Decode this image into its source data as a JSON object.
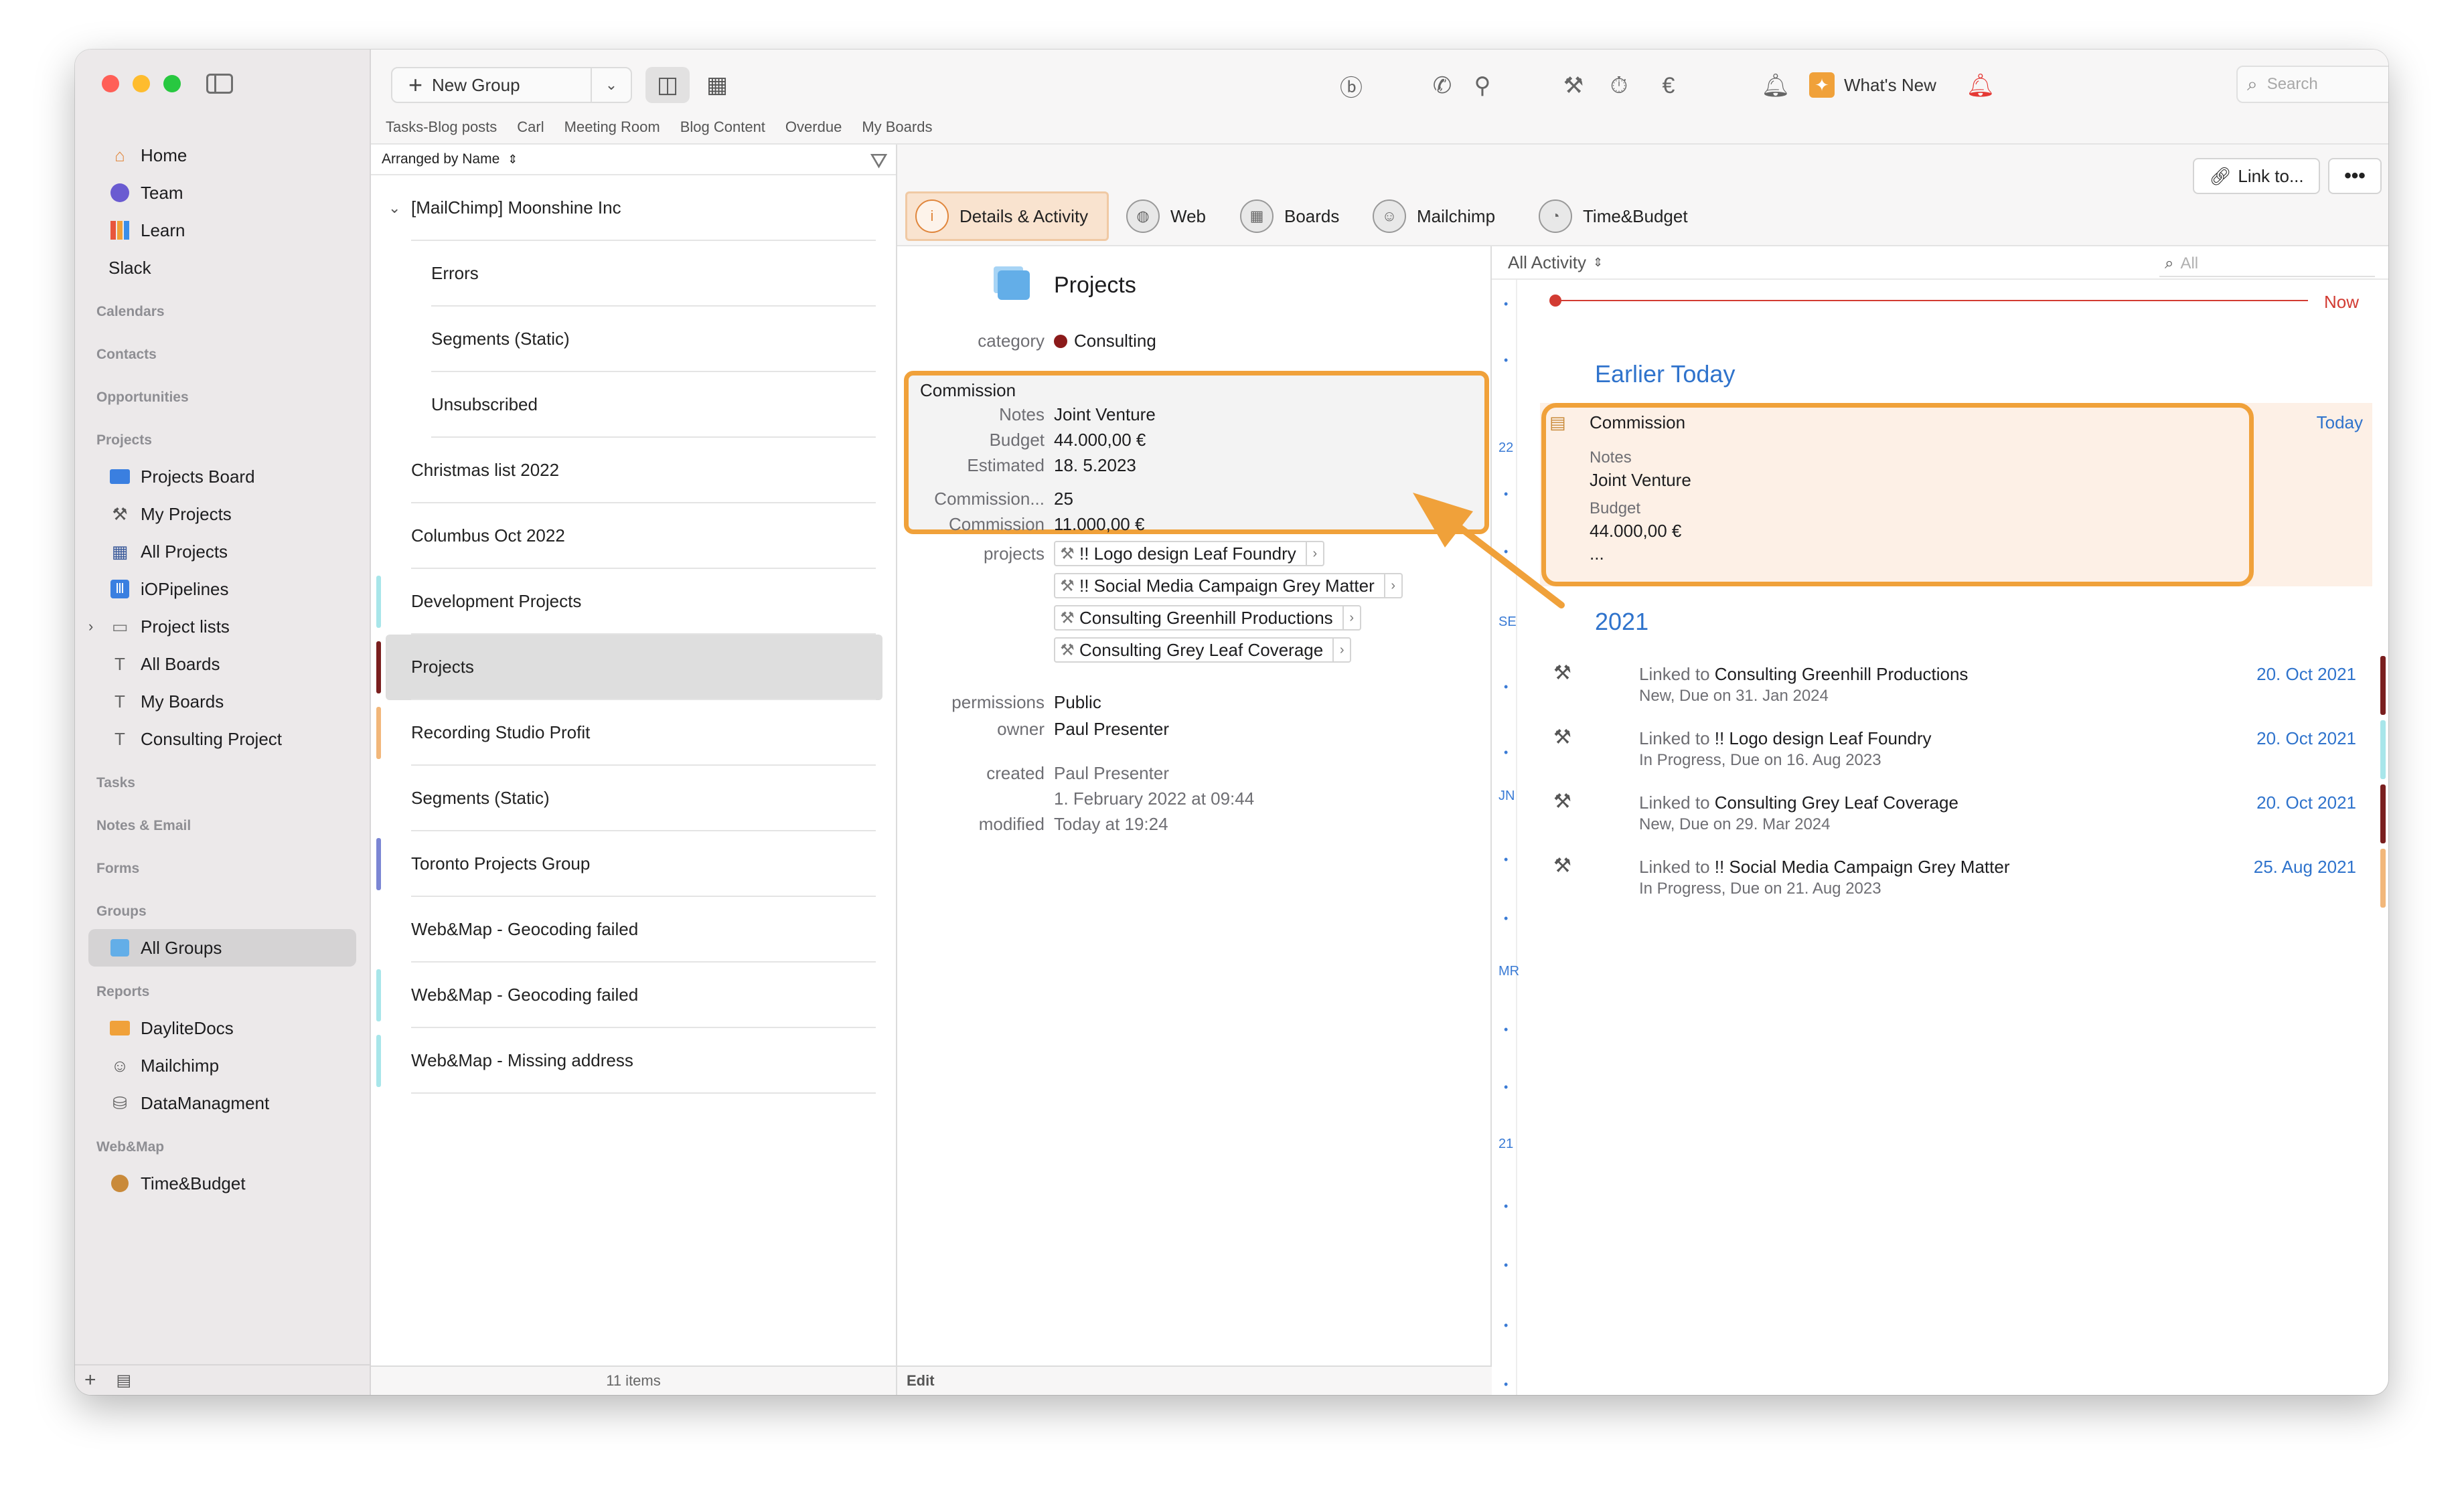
{
  "toolbar": {
    "new_group_label": "New Group",
    "whats_new_label": "What's New",
    "search_placeholder": "Search"
  },
  "tabs_bar": [
    "Tasks-Blog posts",
    "Carl",
    "Meeting Room",
    "Blog Content",
    "Overdue",
    "My Boards"
  ],
  "sidebar": {
    "top_items": [
      {
        "label": "Home",
        "icon": "home-icon"
      },
      {
        "label": "Team",
        "icon": "team-icon"
      },
      {
        "label": "Learn",
        "icon": "books-icon"
      },
      {
        "label": "Slack",
        "icon": ""
      }
    ],
    "sections": {
      "calendars": "Calendars",
      "contacts": "Contacts",
      "opportunities": "Opportunities",
      "projects": "Projects",
      "tasks": "Tasks",
      "notes_email": "Notes & Email",
      "forms": "Forms",
      "groups": "Groups",
      "reports": "Reports",
      "webmap": "Web&Map"
    },
    "project_items": [
      {
        "label": "Projects Board",
        "icon": "folder-blue-icon"
      },
      {
        "label": "My Projects",
        "icon": "hammer-icon"
      },
      {
        "label": "All Projects",
        "icon": "grid-icon"
      },
      {
        "label": "iOPipelines",
        "icon": "pipeline-icon"
      },
      {
        "label": "Project lists",
        "icon": "folder-icon"
      },
      {
        "label": "All Boards",
        "icon": "board-icon"
      },
      {
        "label": "My Boards",
        "icon": "board-icon"
      },
      {
        "label": "Consulting Project",
        "icon": "board-icon"
      }
    ],
    "group_items": [
      {
        "label": "All Groups",
        "icon": "groups-icon"
      }
    ],
    "report_items": [
      {
        "label": "DayliteDocs",
        "icon": "folder-orange-icon"
      },
      {
        "label": "Mailchimp",
        "icon": "mailchimp-icon"
      },
      {
        "label": "DataManagment",
        "icon": "database-icon"
      }
    ],
    "webmap_items": [
      {
        "label": "Time&Budget",
        "icon": "clock-icon"
      }
    ]
  },
  "list": {
    "sort_label": "Arranged by Name",
    "rows": [
      {
        "label": "[MailChimp] Moonshine Inc",
        "bar": ""
      },
      {
        "label": "Errors",
        "bar": ""
      },
      {
        "label": "Segments (Static)",
        "bar": ""
      },
      {
        "label": "Unsubscribed",
        "bar": ""
      },
      {
        "label": "Christmas list 2022",
        "bar": ""
      },
      {
        "label": "Columbus Oct 2022",
        "bar": ""
      },
      {
        "label": "Development Projects",
        "bar": "#a8e6ea"
      },
      {
        "label": "Projects",
        "bar": "#7a1f1f"
      },
      {
        "label": "Recording Studio Profit",
        "bar": "#f2b77a"
      },
      {
        "label": "Segments (Static)",
        "bar": ""
      },
      {
        "label": "Toronto Projects Group",
        "bar": "#7b86d4"
      },
      {
        "label": "Web&Map - Geocoding failed",
        "bar": ""
      },
      {
        "label": "Web&Map - Geocoding failed",
        "bar": "#a8e6ea"
      },
      {
        "label": "Web&Map - Missing address",
        "bar": "#a8e6ea"
      }
    ],
    "footer": "11 items"
  },
  "detail": {
    "link_label": "Link to...",
    "more_label": "•••",
    "tabs": [
      {
        "label": "Details & Activity",
        "icon": "i"
      },
      {
        "label": "Web",
        "icon": "web-icon"
      },
      {
        "label": "Boards",
        "icon": "boards-icon"
      },
      {
        "label": "Mailchimp",
        "icon": "mailchimp-icon"
      },
      {
        "label": "Time&Budget",
        "icon": "clock-icon"
      }
    ],
    "title": "Projects",
    "category_key": "category",
    "category_value": "Consulting",
    "commission_header": "Commission",
    "commission_fields": [
      {
        "k": "Notes",
        "v": "Joint Venture"
      },
      {
        "k": "Budget",
        "v": "44.000,00 €"
      },
      {
        "k": "Estimated",
        "v": "18.  5.2023"
      },
      {
        "k": "Commission...",
        "v": "25"
      },
      {
        "k": "Commission",
        "v": "11.000,00 €"
      }
    ],
    "projects_key": "projects",
    "projects": [
      "!! Logo design Leaf Foundry",
      "!! Social Media Campaign Grey Matter",
      "Consulting Greenhill Productions",
      "Consulting Grey Leaf Coverage"
    ],
    "permissions_key": "permissions",
    "permissions_value": "Public",
    "owner_key": "owner",
    "owner_value": "Paul Presenter",
    "created_key": "created",
    "created_value_1": "Paul Presenter",
    "created_value_2": "1. February 2022 at 09:44",
    "modified_key": "modified",
    "modified_value": "Today at 19:24",
    "footer": "Edit"
  },
  "activity": {
    "filter_label": "All Activity",
    "search_placeholder": "All",
    "now_label": "Now",
    "earlier_today": "Earlier Today",
    "year_2021": "2021",
    "timeline_labels": [
      "22",
      "SE",
      "JN",
      "MR",
      "21"
    ],
    "card": {
      "title": "Commission",
      "date": "Today",
      "notes_key": "Notes",
      "notes_value": "Joint Venture",
      "budget_key": "Budget",
      "budget_value": "44.000,00 €",
      "ellipsis": "..."
    },
    "rows": [
      {
        "prefix": "Linked to ",
        "name": "Consulting Greenhill Productions",
        "sub": "New, Due on 31. Jan 2024",
        "date": "20. Oct 2021",
        "bar": "#7a1f1f"
      },
      {
        "prefix": "Linked to ",
        "name": "!! Logo design Leaf Foundry",
        "sub": "In Progress, Due on 16. Aug 2023",
        "date": "20. Oct 2021",
        "bar": "#a8e6ea"
      },
      {
        "prefix": "Linked to ",
        "name": "Consulting Grey Leaf Coverage",
        "sub": "New, Due on 29. Mar 2024",
        "date": "20. Oct 2021",
        "bar": "#7a1f1f"
      },
      {
        "prefix": "Linked to ",
        "name": "!! Social Media Campaign Grey Matter",
        "sub": "In Progress, Due on 21. Aug 2023",
        "date": "25. Aug 2021",
        "bar": "#f2b77a"
      }
    ]
  },
  "colors": {
    "accent": "#f0a13a",
    "link_blue": "#2f73cc",
    "now_red": "#d23b32"
  }
}
